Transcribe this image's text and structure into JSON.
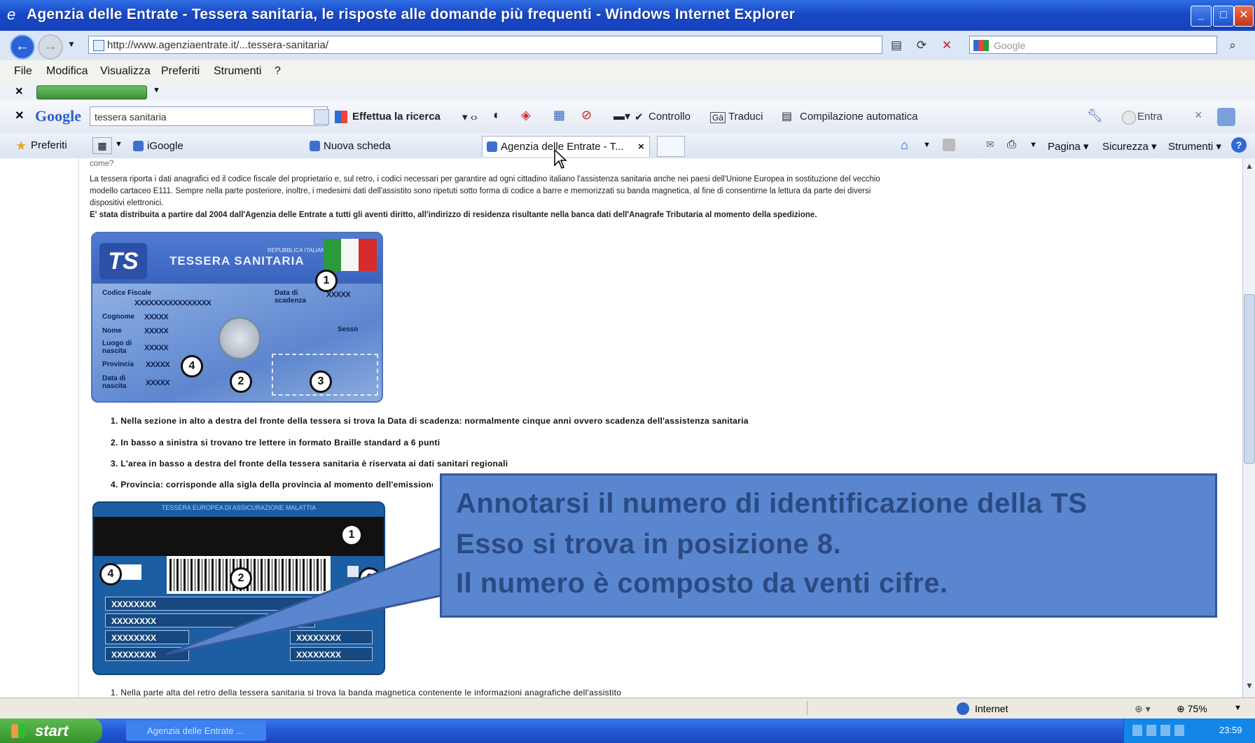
{
  "window": {
    "title": "Agenzia delle Entrate - Tessera sanitaria, le risposte alle domande più frequenti - Windows Internet Explorer"
  },
  "address": {
    "url": "http://www.agenziaentrate.it/...tessera-sanitaria/",
    "search_placeholder": "Google"
  },
  "menu": [
    "File",
    "Modifica",
    "Visualizza",
    "Preferiti",
    "Strumenti",
    "?"
  ],
  "google_toolbar": {
    "logo": "Google",
    "query": "tessera sanitaria",
    "search_button": "Effettua la ricerca",
    "check_label": "Controllo",
    "translate_label": "Traduci",
    "autofill_label": "Compilazione automatica",
    "signin_label": "Entra"
  },
  "tabs": {
    "favorites_label": "Preferiti",
    "items": [
      "iGoogle",
      "Nuova scheda",
      "Agenzia delle Entrate - T..."
    ],
    "right_menus": [
      "Pagina",
      "Sicurezza",
      "Strumenti"
    ]
  },
  "page": {
    "top_cut": "come?",
    "intro_line1": "La tessera riporta i dati anagrafici ed il codice fiscale del proprietario e, sul retro, i codici necessari per garantire ad ogni cittadino italiano l'assistenza sanitaria anche nei paesi dell'Unione Europea in sostituzione del vecchio",
    "intro_line2": "modello cartaceo E111. Sempre nella parte posteriore, inoltre, i medesimi dati dell'assistito sono ripetuti sotto forma di codice a barre e memorizzati su banda magnetica, al fine di consentirne la lettura da parte dei diversi",
    "intro_line3": "dispositivi elettronici.",
    "intro_line4": "E' stata distribuita a partire dal 2004 dall'Agenzia delle Entrate a tutti gli aventi diritto, all'indirizzo di residenza risultante nella banca dati dell'Anagrafe Tributaria al momento della spedizione.",
    "list": [
      "1.  Nella sezione in alto a destra del fronte della tessera si trova la Data di scadenza: normalmente cinque anni ovvero scadenza dell'assistenza sanitaria",
      "2.  In basso a sinistra si trovano tre lettere in formato Braille standard a 6 punti",
      "3.  L'area in basso a destra del fronte della tessera sanitaria è riservata ai dati sanitari regionali",
      "4.  Provincia: corrisponde alla sigla della provincia al momento dell'emissione della tessera"
    ],
    "bottom_cut": "1.  Nella parte alta del retro della tessera sanitaria si trova la banda magnetica contenente le informazioni anagrafiche dell'assistito"
  },
  "card_front": {
    "logo": "TS",
    "republic": "REPUBBLICA ITALIANA",
    "title": "TESSERA SANITARIA",
    "fields": [
      "Codice Fiscale",
      "Cognome",
      "Nome",
      "Luogo di nascita",
      "Provincia",
      "Data di nascita"
    ],
    "expiry_label": "Data di scadenza",
    "sex_label": "Sesso",
    "mask": "XXXXXXXXXXXXXXXX",
    "mask_short": "XXXXX",
    "markers": [
      "1",
      "2",
      "3",
      "4"
    ]
  },
  "card_back": {
    "header": "TESSERA EUROPEA DI ASSICURAZIONE MALATTIA",
    "rows": [
      "XXXXXXXX",
      "XXXXXXXX",
      "XXXXXXXX",
      "XXXXXXXX"
    ],
    "rows_right": [
      "XXXXXXXX",
      "XXXXXXXX"
    ],
    "markers": [
      "1",
      "2",
      "3",
      "4"
    ]
  },
  "callout": {
    "line1": "Annotarsi il numero di identificazione della TS",
    "line2": "Esso si trova in posizione 8.",
    "line3": "Il numero è composto da venti cifre."
  },
  "status": {
    "zone": "Internet",
    "zoom": "75%"
  },
  "taskbar": {
    "start": "start",
    "item": "Agenzia delle Entrate ...",
    "clock": "23:59"
  }
}
